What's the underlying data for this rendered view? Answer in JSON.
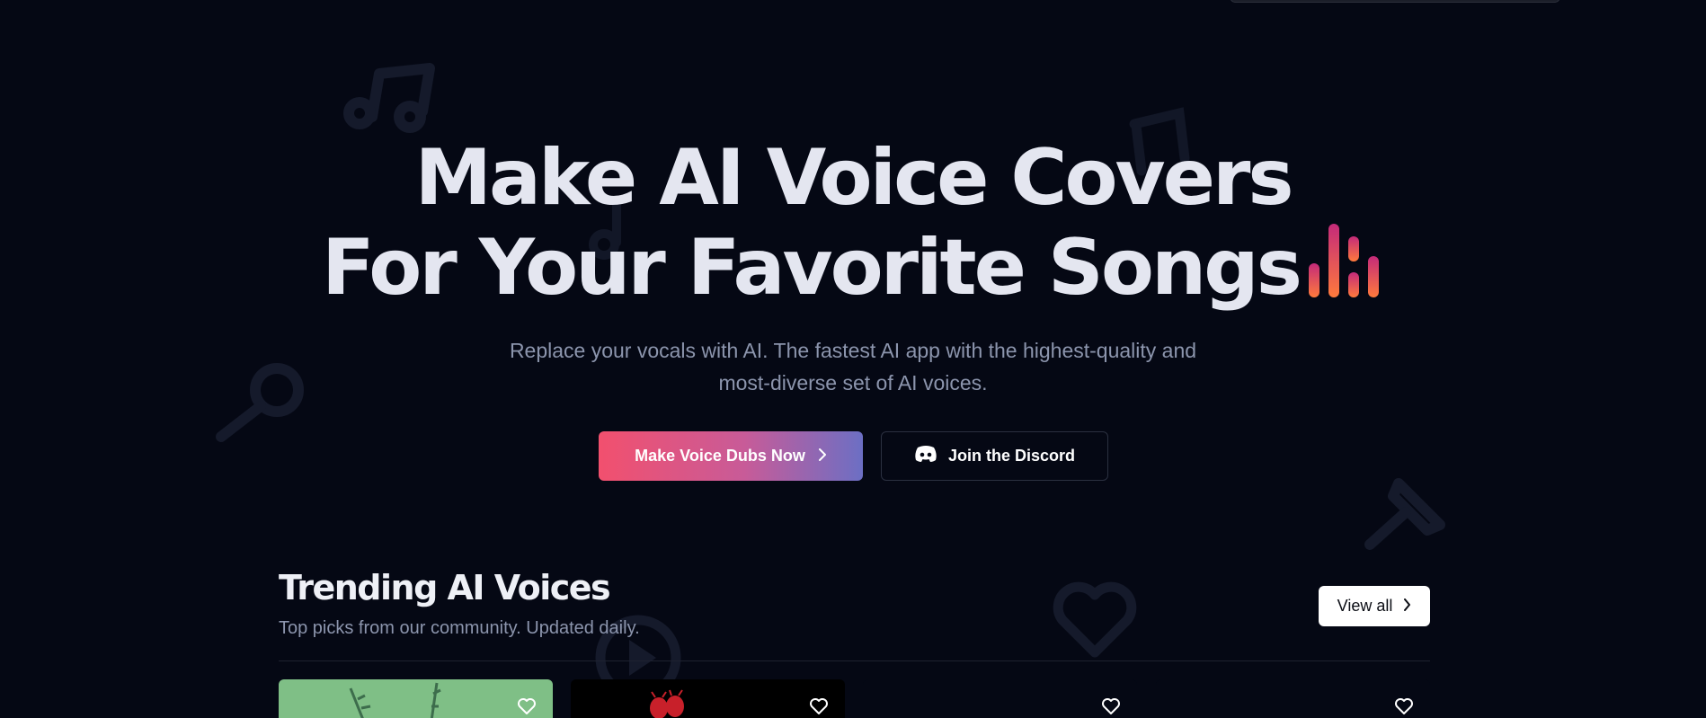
{
  "hero": {
    "title_line1": "Make AI Voice Covers",
    "title_line2": "For Your Favorite Songs",
    "subtitle_line1": "Replace your vocals with AI. The fastest AI app with the highest-quality and",
    "subtitle_line2": "most-diverse set of AI voices."
  },
  "buttons": {
    "primary_label": "Make Voice Dubs Now",
    "secondary_label": "Join the Discord"
  },
  "trending": {
    "title": "Trending AI Voices",
    "subtitle": "Top picks from our community. Updated daily.",
    "view_all_label": "View all",
    "cards": [
      {
        "background": "#7fbf86"
      },
      {
        "background": "#000000"
      },
      {
        "background": "#050814"
      },
      {
        "background": "#050814"
      }
    ]
  },
  "colors": {
    "background": "#050814",
    "accent_start": "#f2506e",
    "accent_end": "#6c6fc4",
    "muted_text": "#8c95ad"
  },
  "icons": [
    "music-note-icon",
    "microphone-icon",
    "heart-icon",
    "play-icon",
    "discord-icon",
    "chevron-right-icon",
    "sound-bars-icon"
  ]
}
